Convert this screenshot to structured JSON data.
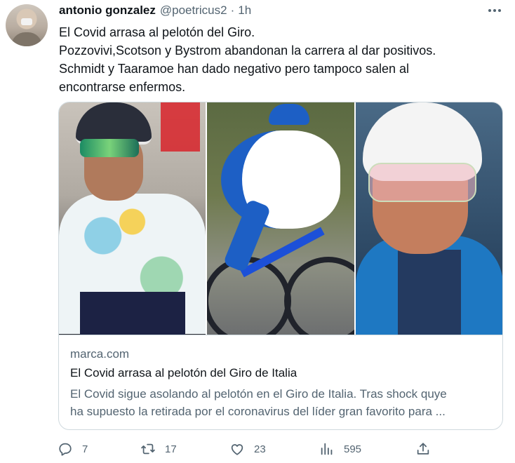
{
  "tweet": {
    "author_name": "antonio gonzalez",
    "author_handle": "@poetricus2",
    "separator": "·",
    "time": "1h",
    "text_lines": [
      "El Covid arrasa al pelotón del Giro.",
      "Pozzovivi,Scotson y Bystrom abandonan la carrera al dar positivos.",
      "Schmidt y Taaramoe han dado negativo pero tampoco salen al",
      "encontrarse enfermos."
    ]
  },
  "card": {
    "domain": "marca.com",
    "title": "El Covid arrasa al pelotón del Giro de Italia",
    "description_lines": [
      "El Covid sigue asolando al pelotón en el Giro de Italia. Tras shock quye",
      "ha supuesto la retirada por el coronavirus del líder gran favorito para ..."
    ]
  },
  "actions": {
    "replies": "7",
    "retweets": "17",
    "likes": "23",
    "views": "595"
  },
  "icons": {
    "more": "more-dots-icon",
    "reply": "reply-icon",
    "retweet": "retweet-icon",
    "like": "heart-icon",
    "views": "views-chart-icon",
    "share": "share-icon"
  }
}
